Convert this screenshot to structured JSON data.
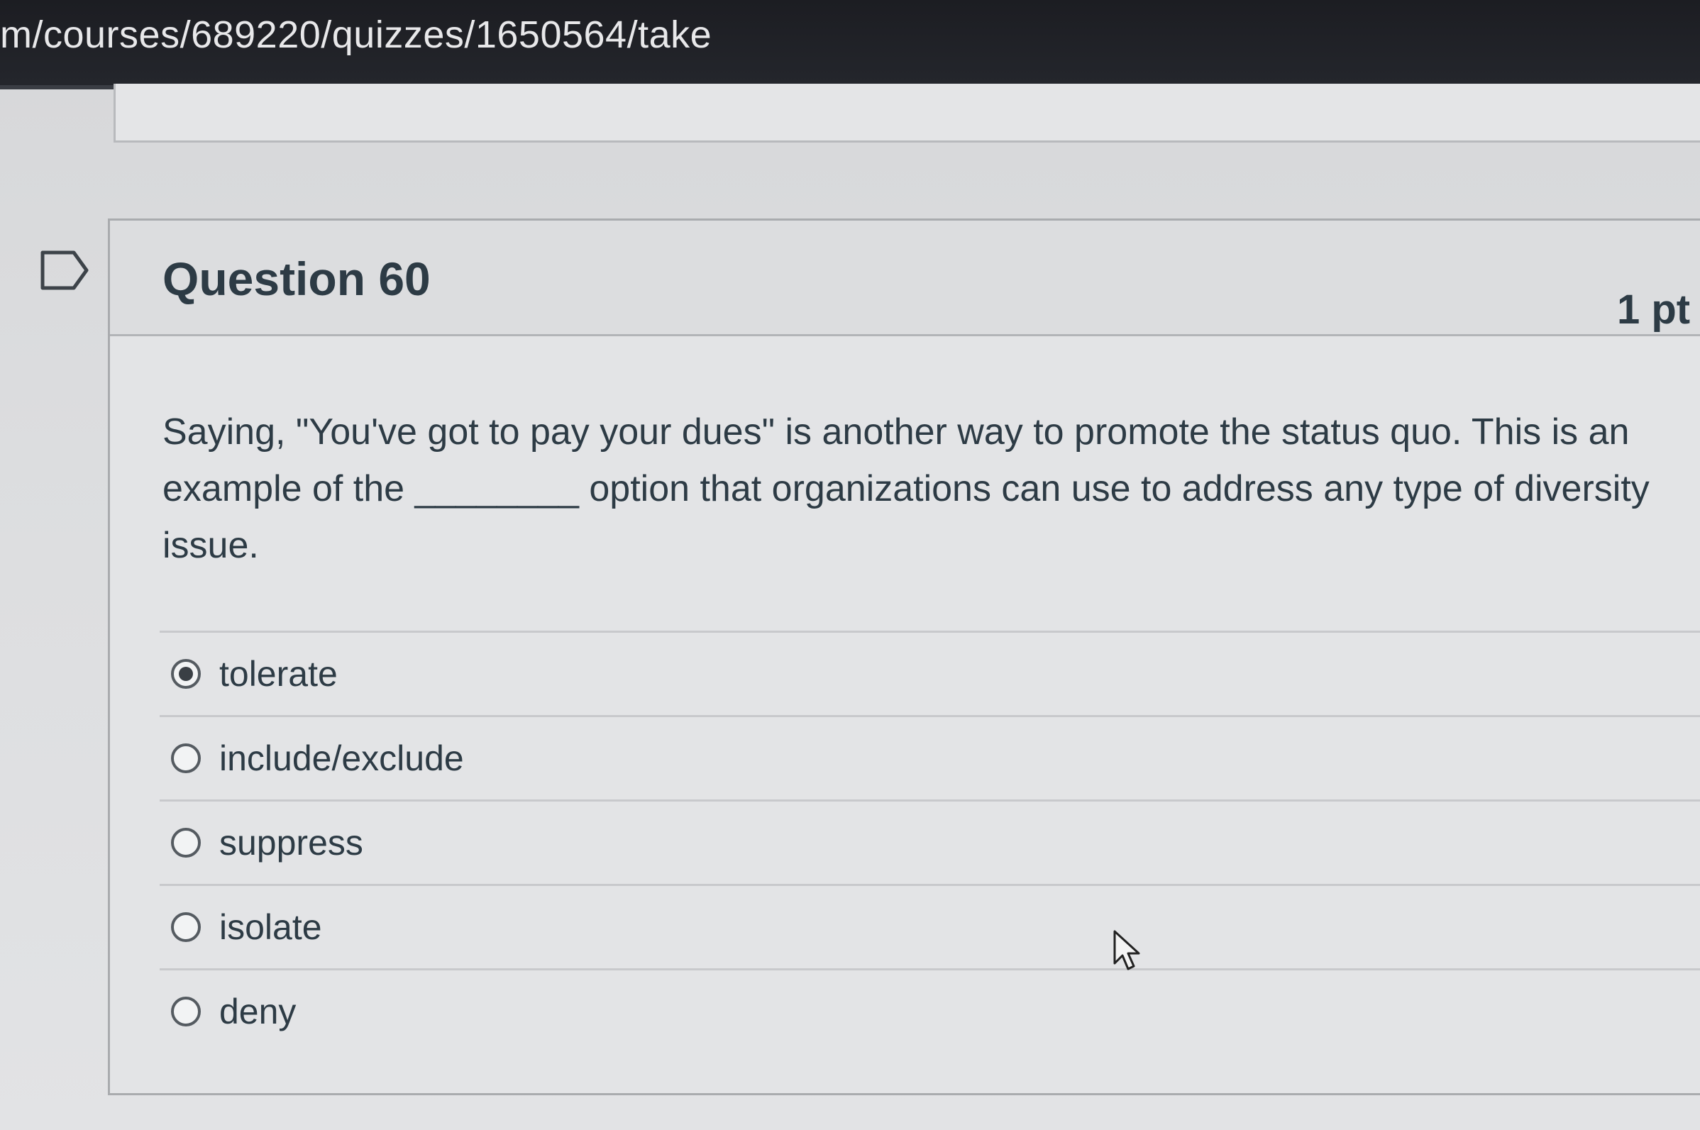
{
  "browser": {
    "url": "m/courses/689220/quizzes/1650564/take"
  },
  "question": {
    "title": "Question 60",
    "points": "1 pt",
    "text": "Saying, \"You've got to pay your dues\" is another way to promote the status quo. This is an example of the ________ option that organizations can use to address any type of diversity issue.",
    "answers": [
      {
        "label": "tolerate",
        "selected": true
      },
      {
        "label": "include/exclude",
        "selected": false
      },
      {
        "label": "suppress",
        "selected": false
      },
      {
        "label": "isolate",
        "selected": false
      },
      {
        "label": "deny",
        "selected": false
      }
    ]
  },
  "icons": {
    "flag": "flag-icon",
    "cursor": "mouse-pointer-icon"
  }
}
